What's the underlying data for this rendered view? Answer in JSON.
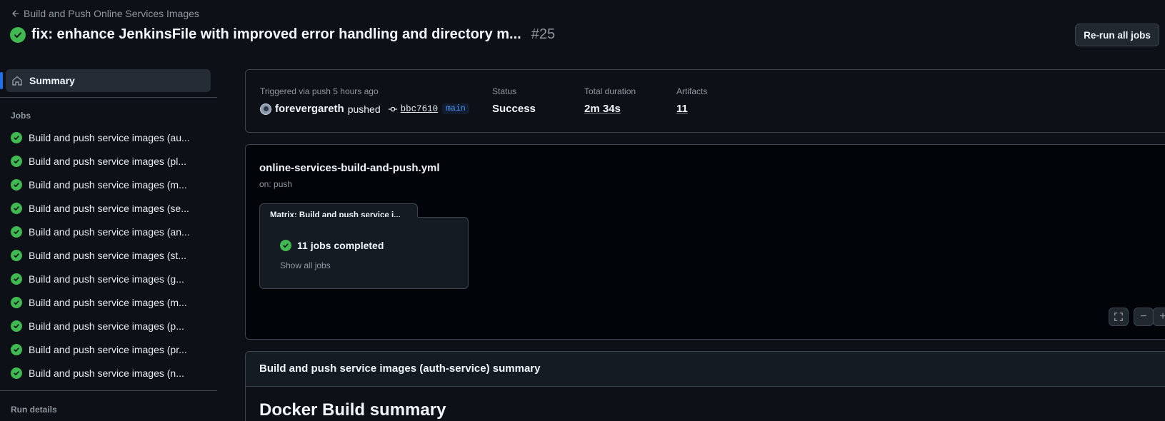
{
  "header": {
    "back_label": "Build and Push Online Services Images",
    "title": "fix: enhance JenkinsFile with improved error handling and directory m...",
    "run_number": "#25",
    "rerun_label": "Re-run all jobs"
  },
  "sidebar": {
    "summary_label": "Summary",
    "jobs_heading": "Jobs",
    "jobs": [
      "Build and push service images (au...",
      "Build and push service images (pl...",
      "Build and push service images (m...",
      "Build and push service images (se...",
      "Build and push service images (an...",
      "Build and push service images (st...",
      "Build and push service images (g...",
      "Build and push service images (m...",
      "Build and push service images (p...",
      "Build and push service images (pr...",
      "Build and push service images (n..."
    ],
    "run_details_heading": "Run details"
  },
  "run_info": {
    "trigger_label": "Triggered via push 5 hours ago",
    "user": "forevergareth",
    "action": "pushed",
    "commit": "bbc7610",
    "branch": "main",
    "status_label": "Status",
    "status_value": "Success",
    "duration_label": "Total duration",
    "duration_value": "2m 34s",
    "artifacts_label": "Artifacts",
    "artifacts_value": "11"
  },
  "workflow": {
    "file": "online-services-build-and-push.yml",
    "trigger": "on: push",
    "matrix_title": "Matrix: Build and push service i...",
    "matrix_status": "11 jobs completed",
    "matrix_link": "Show all jobs"
  },
  "zoom": {
    "minus": "−",
    "plus": "+"
  },
  "job_summary": {
    "title": "Build and push service images (auth-service) summary",
    "docker_title": "Docker Build summary"
  },
  "colors": {
    "background": "#0d1117",
    "success": "#3fb950",
    "accent": "#1f6feb",
    "branch": "#4493f8"
  }
}
